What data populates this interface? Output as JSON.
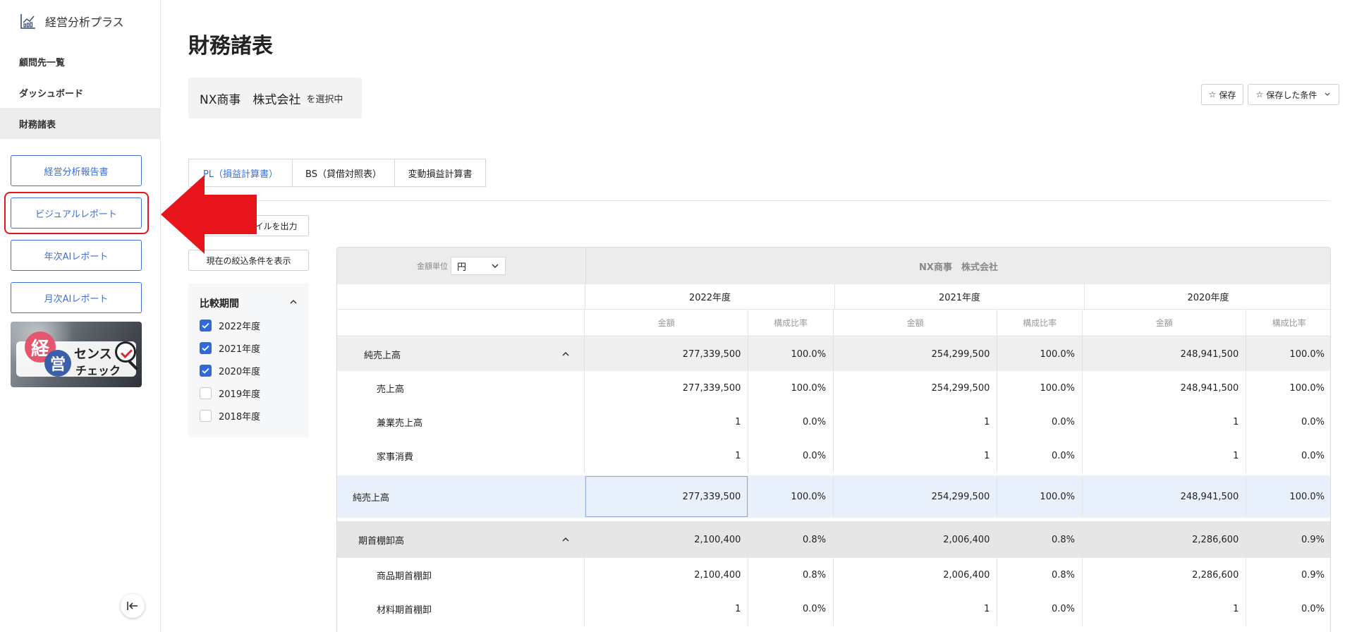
{
  "sidebar": {
    "brand": "経営分析プラス",
    "nav": [
      "顧問先一覧",
      "ダッシュボード",
      "財務諸表"
    ],
    "active_nav": "財務諸表",
    "buttons": [
      "経営分析報告書",
      "ビジュアルレポート",
      "年次AIレポート",
      "月次AIレポート"
    ],
    "banner": {
      "kei": "経",
      "ei": "営",
      "sense": "センス",
      "check": "チェック"
    }
  },
  "header": {
    "title": "財務諸表",
    "client_name": "NX商事　株式会社",
    "client_suffix": "を選択中",
    "save_label": "保存",
    "saved_conditions_label": "保存した条件"
  },
  "tabs": [
    "PL（損益計算書）",
    "BS（貸借対照表）",
    "変動損益計算書"
  ],
  "active_tab": "PL（損益計算書）",
  "actions": {
    "export_label": "イルを出力",
    "show_filter_label": "現在の絞込条件を表示"
  },
  "filter": {
    "title": "比較期間",
    "options": [
      {
        "label": "2022年度",
        "checked": true
      },
      {
        "label": "2021年度",
        "checked": true
      },
      {
        "label": "2020年度",
        "checked": true
      },
      {
        "label": "2019年度",
        "checked": false
      },
      {
        "label": "2018年度",
        "checked": false
      }
    ]
  },
  "colors": {
    "accent": "#3d6fd6",
    "highlight": "#e8141c",
    "checkbox": "#2f6bd8"
  },
  "table": {
    "unit_label": "金額単位",
    "unit_value": "円",
    "company": "NX商事　株式会社",
    "years": [
      "2022年度",
      "2021年度",
      "2020年度"
    ],
    "sub_headers": {
      "amount": "金額",
      "ratio": "構成比率"
    },
    "rows": [
      {
        "label": "純売上高",
        "values": [
          "277,339,500",
          "100.0%",
          "254,299,500",
          "100.0%",
          "248,941,500",
          "100.0%"
        ]
      },
      {
        "label": "売上高",
        "values": [
          "277,339,500",
          "100.0%",
          "254,299,500",
          "100.0%",
          "248,941,500",
          "100.0%"
        ]
      },
      {
        "label": "兼業売上高",
        "values": [
          "1",
          "0.0%",
          "1",
          "0.0%",
          "1",
          "0.0%"
        ]
      },
      {
        "label": "家事消費",
        "values": [
          "1",
          "0.0%",
          "1",
          "0.0%",
          "1",
          "0.0%"
        ]
      },
      {
        "label": "純売上高",
        "values": [
          "277,339,500",
          "100.0%",
          "254,299,500",
          "100.0%",
          "248,941,500",
          "100.0%"
        ]
      },
      {
        "label": "期首棚卸高",
        "values": [
          "2,100,400",
          "0.8%",
          "2,006,400",
          "0.8%",
          "2,286,600",
          "0.9%"
        ]
      },
      {
        "label": "商品期首棚卸",
        "values": [
          "2,100,400",
          "0.8%",
          "2,006,400",
          "0.8%",
          "2,286,600",
          "0.9%"
        ]
      },
      {
        "label": "材料期首棚卸",
        "values": [
          "1",
          "0.0%",
          "1",
          "0.0%",
          "1",
          "0.0%"
        ]
      }
    ]
  }
}
